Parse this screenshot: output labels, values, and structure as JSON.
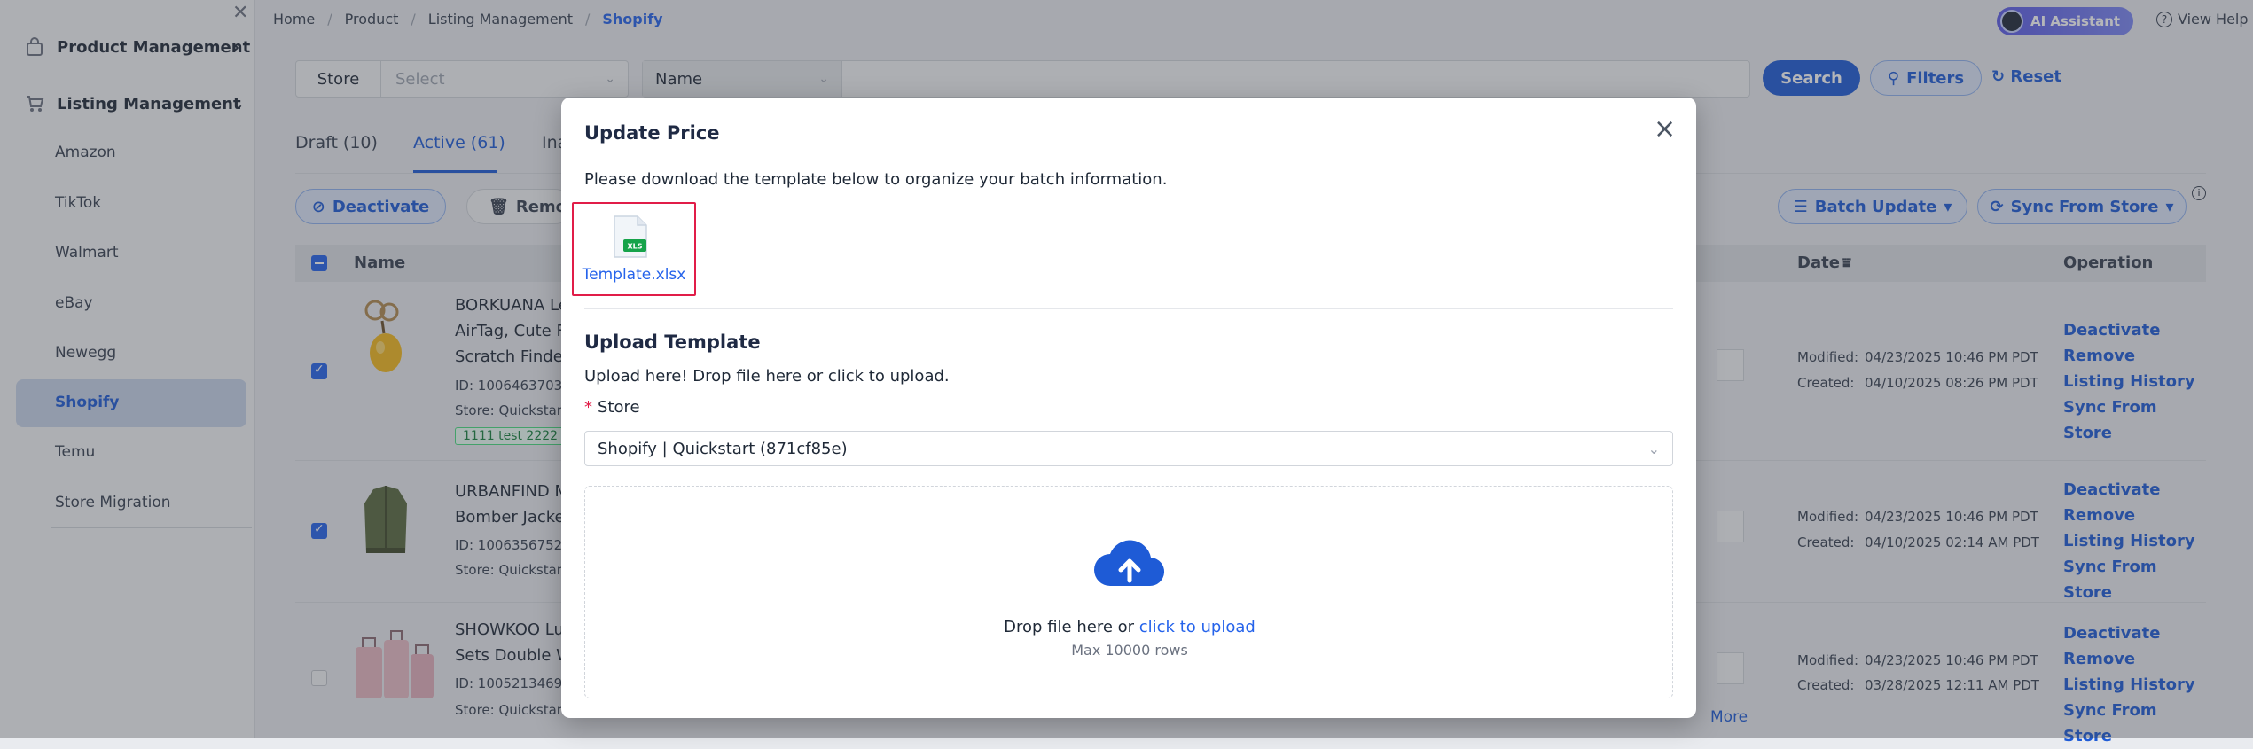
{
  "sidebar": {
    "groups": [
      {
        "label": "Product Management",
        "icon": "bag-icon"
      },
      {
        "label": "Listing Management",
        "icon": "cart-icon"
      }
    ],
    "items": [
      "Amazon",
      "TikTok",
      "Walmart",
      "eBay",
      "Newegg",
      "Shopify",
      "Temu",
      "Store Migration"
    ],
    "active": "Shopify"
  },
  "breadcrumb": [
    "Home",
    "Product",
    "Listing Management",
    "Shopify"
  ],
  "header": {
    "ai_label": "AI Assistant",
    "help_label": "View Help"
  },
  "filters": {
    "store_label": "Store",
    "store_placeholder": "Select",
    "field_select": "Name",
    "search_label": "Search",
    "filters_label": "Filters",
    "reset_label": "Reset"
  },
  "tabs": [
    {
      "label": "Draft (10)"
    },
    {
      "label": "Active (61)"
    },
    {
      "label": "Ina"
    }
  ],
  "actions": {
    "deactivate": "Deactivate",
    "remove": "Remov",
    "batch_update": "Batch Update",
    "sync_from_store": "Sync From Store"
  },
  "table": {
    "headers": {
      "name": "Name",
      "date": "Date",
      "operation": "Operation"
    },
    "rows": [
      {
        "title": [
          "BORKUANA Le",
          "AirTag, Cute F",
          "Scratch Finde"
        ],
        "id": "ID: 10064637034",
        "store": "Store: Quickstar",
        "tag": "1111 test 2222",
        "modified_label": "Modified:",
        "modified": "04/23/2025 10:46 PM PDT",
        "created_label": "Created:",
        "created": "04/10/2025 08:26 PM PDT",
        "checked": true
      },
      {
        "title": [
          "URBANFIND M",
          "Bomber Jacke"
        ],
        "id": "ID: 10063567520",
        "store": "Store: Quickstar",
        "modified_label": "Modified:",
        "modified": "04/23/2025 10:46 PM PDT",
        "created_label": "Created:",
        "created": "04/10/2025 02:14 AM PDT",
        "checked": true
      },
      {
        "title": [
          "SHOWKOO Lu",
          "Sets Double W"
        ],
        "id": "ID: 10052134699",
        "store": "Store: Quickstar",
        "more": "More",
        "modified_label": "Modified:",
        "modified": "04/23/2025 10:46 PM PDT",
        "created_label": "Created:",
        "created": "03/28/2025 12:11 AM PDT",
        "checked": false
      }
    ],
    "operations": [
      "Deactivate",
      "Remove",
      "Listing History",
      "Sync From Store"
    ]
  },
  "modal": {
    "title": "Update Price",
    "description": "Please download the template below to organize your batch information.",
    "template_file": "Template.xlsx",
    "file_badge": "XLS",
    "upload_title": "Upload Template",
    "upload_hint": "Upload here! Drop file here or click to upload.",
    "store_label": "Store",
    "store_value": "Shopify | Quickstart (871cf85e)",
    "drop_text": "Drop file here or",
    "drop_link": "click to upload",
    "drop_max": "Max 10000 rows"
  },
  "colors": {
    "accent": "#1e5bd6",
    "highlight_border": "#e11d48",
    "tag_green": "#15803d"
  }
}
